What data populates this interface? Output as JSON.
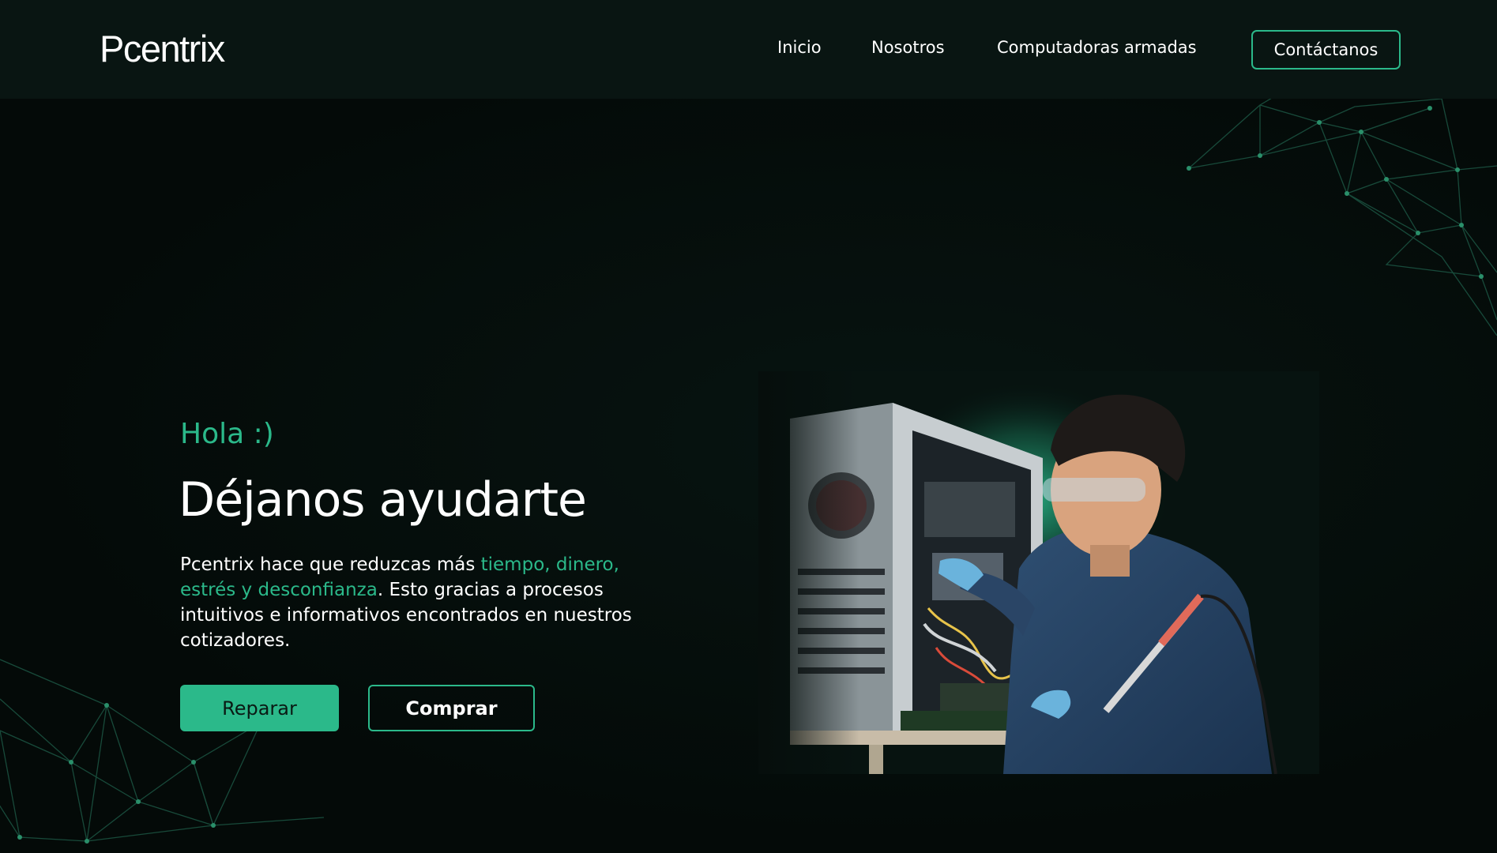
{
  "nav": {
    "logo": "Pcentrix",
    "links": [
      "Inicio",
      "Nosotros",
      "Computadoras armadas"
    ],
    "contact_label": "Contáctanos"
  },
  "hero": {
    "greeting": "Hola :)",
    "headline": "Déjanos ayudarte",
    "description": {
      "prefix": "Pcentrix hace que reduzcas más ",
      "highlight": "tiempo, dinero, estrés y desconfianza",
      "suffix": ". Esto gracias a procesos intuitivos e informativos encontrados en nuestros cotizadores."
    },
    "primary_button": "Reparar",
    "secondary_button": "Comprar"
  },
  "colors": {
    "accent": "#2bb98a",
    "background": "#060e0c",
    "navbar": "#091512"
  },
  "icons": [
    "network-mesh-decoration"
  ]
}
